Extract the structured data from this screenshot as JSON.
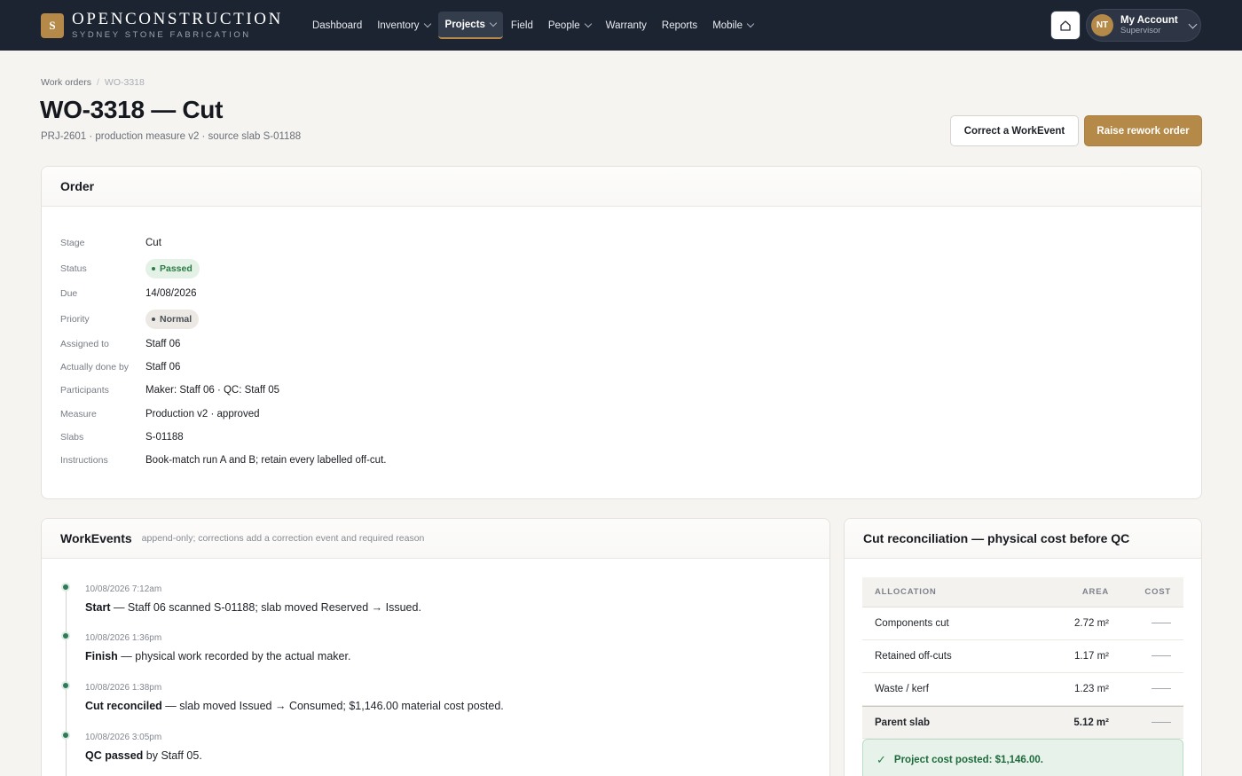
{
  "brand": {
    "mark": "S",
    "name": "OPENCONSTRUCTION",
    "subtitle": "SYDNEY STONE FABRICATION"
  },
  "nav": {
    "items": [
      {
        "label": "Dashboard"
      },
      {
        "label": "Inventory"
      },
      {
        "label": "Projects"
      },
      {
        "label": "Field"
      },
      {
        "label": "People"
      },
      {
        "label": "Warranty"
      },
      {
        "label": "Reports"
      },
      {
        "label": "Mobile"
      }
    ]
  },
  "account": {
    "initials": "NT",
    "name": "My Account",
    "role": "Supervisor"
  },
  "breadcrumb": {
    "parent": "Work orders",
    "separator": "/",
    "current": "WO-3318"
  },
  "page": {
    "title": "WO-3318 — Cut",
    "subtitle": "PRJ-2601 · production measure v2 · source slab S-01188"
  },
  "actions": {
    "correct_label": "Correct a WorkEvent",
    "rework_label": "Raise rework order"
  },
  "order": {
    "title": "Order",
    "fields": {
      "stage": {
        "label": "Stage",
        "value": "Cut"
      },
      "status": {
        "label": "Status",
        "value": "Passed"
      },
      "due": {
        "label": "Due",
        "value": "14/08/2026"
      },
      "priority": {
        "label": "Priority",
        "value": "Normal"
      },
      "assigned": {
        "label": "Assigned to",
        "value": "Staff 06"
      },
      "done_by": {
        "label": "Actually done by",
        "value": "Staff 06"
      },
      "participants": {
        "label": "Participants",
        "value": "Maker: Staff 06 · QC: Staff 05"
      },
      "measure": {
        "label": "Measure",
        "value": "Production v2 · approved"
      },
      "slabs": {
        "label": "Slabs",
        "value": "S-01188"
      },
      "instructions": {
        "label": "Instructions",
        "value": "Book-match run A and B; retain every labelled off-cut."
      }
    }
  },
  "events": {
    "title": "WorkEvents",
    "note": "append-only; corrections add a correction event and required reason",
    "items": [
      {
        "time": "10/08/2026 7:12am",
        "name": "Start",
        "desc": " — Staff 06 scanned S-01188; slab moved Reserved → Issued."
      },
      {
        "time": "10/08/2026 1:36pm",
        "name": "Finish",
        "desc": " — physical work recorded by the actual maker."
      },
      {
        "time": "10/08/2026 1:38pm",
        "name": "Cut reconciled",
        "desc": " — slab moved Issued → Consumed; $1,146.00 material cost posted."
      },
      {
        "time": "10/08/2026 3:05pm",
        "name": "QC passed",
        "desc": " by Staff 05."
      }
    ]
  },
  "reconciliation": {
    "title": "Cut reconciliation — physical cost before QC",
    "columns": [
      "ALLOCATION",
      "AREA",
      "COST"
    ],
    "rows": [
      {
        "allocation": "Components cut",
        "area": "2.72 m²"
      },
      {
        "allocation": "Retained off-cuts",
        "area": "1.17 m²"
      },
      {
        "allocation": "Waste / kerf",
        "area": "1.23 m²"
      }
    ],
    "total": {
      "allocation": "Parent slab",
      "area": "5.12 m²"
    },
    "posted": "Project cost posted: $1,146.00."
  },
  "colors": {
    "nav_bg": "#1c2431",
    "accent": "#b58a48",
    "success": "#2c7b45",
    "timeline_dot": "#2f7a58"
  },
  "icons": {
    "home": "home-icon",
    "chevron": "chevron-down-icon",
    "check": "check-icon",
    "status_dot": "dot-icon"
  }
}
